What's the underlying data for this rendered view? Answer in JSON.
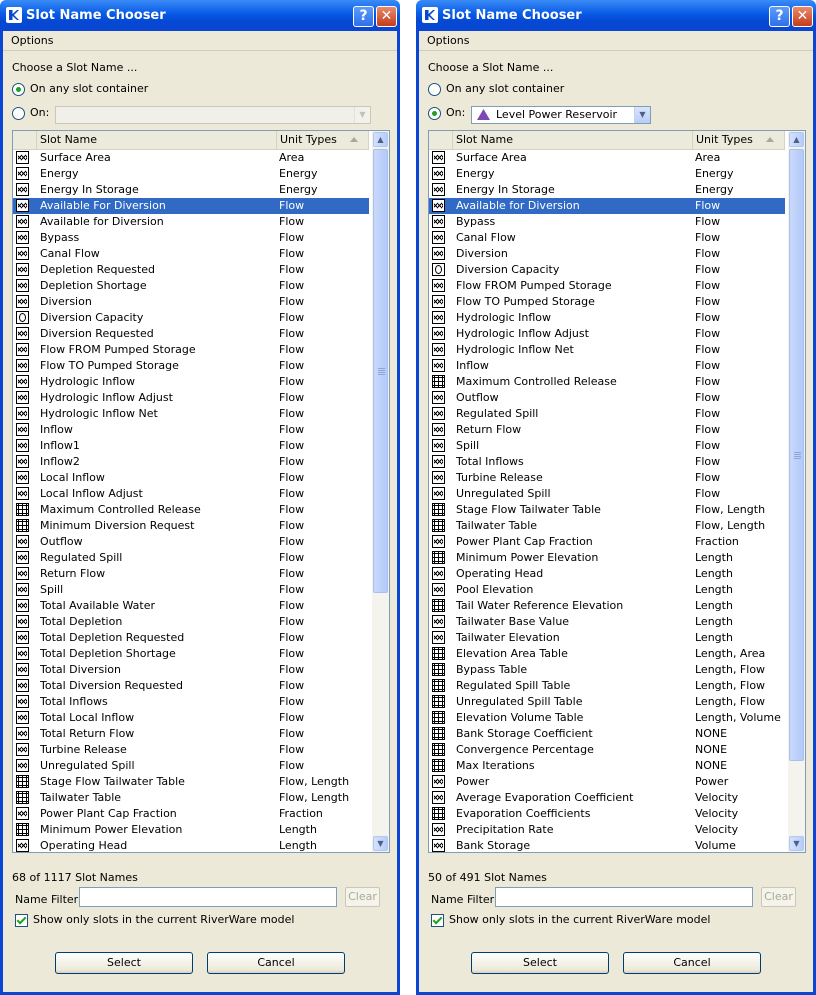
{
  "dialogs": [
    {
      "title": "Slot Name Chooser",
      "menu": "Options",
      "choose_label": "Choose a Slot Name ...",
      "radio_any": "On any slot container",
      "radio_on": "On:",
      "selected_radio": "any",
      "on_value": "",
      "columns": [
        "Slot Name",
        "Unit Types"
      ],
      "selected_index": 3,
      "rows": [
        {
          "icon": "graph",
          "name": "Surface Area",
          "unit": "Area"
        },
        {
          "icon": "graph",
          "name": "Energy",
          "unit": "Energy"
        },
        {
          "icon": "graph",
          "name": "Energy In Storage",
          "unit": "Energy"
        },
        {
          "icon": "graph",
          "name": "Available For Diversion",
          "unit": "Flow"
        },
        {
          "icon": "graph",
          "name": "Available for Diversion",
          "unit": "Flow"
        },
        {
          "icon": "graph",
          "name": "Bypass",
          "unit": "Flow"
        },
        {
          "icon": "graph",
          "name": "Canal Flow",
          "unit": "Flow"
        },
        {
          "icon": "graph",
          "name": "Depletion Requested",
          "unit": "Flow"
        },
        {
          "icon": "graph",
          "name": "Depletion Shortage",
          "unit": "Flow"
        },
        {
          "icon": "graph",
          "name": "Diversion",
          "unit": "Flow"
        },
        {
          "icon": "circle",
          "name": "Diversion Capacity",
          "unit": "Flow"
        },
        {
          "icon": "graph",
          "name": "Diversion Requested",
          "unit": "Flow"
        },
        {
          "icon": "graph",
          "name": "Flow FROM Pumped Storage",
          "unit": "Flow"
        },
        {
          "icon": "graph",
          "name": "Flow TO Pumped Storage",
          "unit": "Flow"
        },
        {
          "icon": "graph",
          "name": "Hydrologic Inflow",
          "unit": "Flow"
        },
        {
          "icon": "graph",
          "name": "Hydrologic Inflow Adjust",
          "unit": "Flow"
        },
        {
          "icon": "graph",
          "name": "Hydrologic Inflow Net",
          "unit": "Flow"
        },
        {
          "icon": "graph",
          "name": "Inflow",
          "unit": "Flow"
        },
        {
          "icon": "graph",
          "name": "Inflow1",
          "unit": "Flow"
        },
        {
          "icon": "graph",
          "name": "Inflow2",
          "unit": "Flow"
        },
        {
          "icon": "graph",
          "name": "Local Inflow",
          "unit": "Flow"
        },
        {
          "icon": "graph",
          "name": "Local Inflow Adjust",
          "unit": "Flow"
        },
        {
          "icon": "table",
          "name": "Maximum Controlled Release",
          "unit": "Flow"
        },
        {
          "icon": "table",
          "name": "Minimum Diversion Request",
          "unit": "Flow"
        },
        {
          "icon": "graph",
          "name": "Outflow",
          "unit": "Flow"
        },
        {
          "icon": "graph",
          "name": "Regulated Spill",
          "unit": "Flow"
        },
        {
          "icon": "graph",
          "name": "Return Flow",
          "unit": "Flow"
        },
        {
          "icon": "graph",
          "name": "Spill",
          "unit": "Flow"
        },
        {
          "icon": "graph",
          "name": "Total Available Water",
          "unit": "Flow"
        },
        {
          "icon": "graph",
          "name": "Total Depletion",
          "unit": "Flow"
        },
        {
          "icon": "graph",
          "name": "Total Depletion Requested",
          "unit": "Flow"
        },
        {
          "icon": "graph",
          "name": "Total Depletion Shortage",
          "unit": "Flow"
        },
        {
          "icon": "graph",
          "name": "Total Diversion",
          "unit": "Flow"
        },
        {
          "icon": "graph",
          "name": "Total Diversion Requested",
          "unit": "Flow"
        },
        {
          "icon": "graph",
          "name": "Total Inflows",
          "unit": "Flow"
        },
        {
          "icon": "graph",
          "name": "Total Local Inflow",
          "unit": "Flow"
        },
        {
          "icon": "graph",
          "name": "Total Return Flow",
          "unit": "Flow"
        },
        {
          "icon": "graph",
          "name": "Turbine Release",
          "unit": "Flow"
        },
        {
          "icon": "graph",
          "name": "Unregulated Spill",
          "unit": "Flow"
        },
        {
          "icon": "table",
          "name": "Stage Flow Tailwater Table",
          "unit": "Flow, Length"
        },
        {
          "icon": "table",
          "name": "Tailwater Table",
          "unit": "Flow, Length"
        },
        {
          "icon": "graph",
          "name": "Power Plant Cap Fraction",
          "unit": "Fraction"
        },
        {
          "icon": "table",
          "name": "Minimum Power Elevation",
          "unit": "Length"
        },
        {
          "icon": "graph",
          "name": "Operating Head",
          "unit": "Length"
        }
      ],
      "count_text": "68 of 1117 Slot Names",
      "filter_label": "Name Filter:",
      "filter_value": "",
      "clear_label": "Clear",
      "checkbox_label": "Show only slots in the current RiverWare model",
      "select_label": "Select",
      "cancel_label": "Cancel"
    },
    {
      "title": "Slot Name Chooser",
      "menu": "Options",
      "choose_label": "Choose a Slot Name ...",
      "radio_any": "On any slot container",
      "radio_on": "On:",
      "selected_radio": "on",
      "on_value": "Level Power Reservoir",
      "columns": [
        "Slot Name",
        "Unit Types"
      ],
      "selected_index": 3,
      "rows": [
        {
          "icon": "graph",
          "name": "Surface Area",
          "unit": "Area"
        },
        {
          "icon": "graph",
          "name": "Energy",
          "unit": "Energy"
        },
        {
          "icon": "graph",
          "name": "Energy In Storage",
          "unit": "Energy"
        },
        {
          "icon": "graph",
          "name": "Available for Diversion",
          "unit": "Flow"
        },
        {
          "icon": "graph",
          "name": "Bypass",
          "unit": "Flow"
        },
        {
          "icon": "graph",
          "name": "Canal Flow",
          "unit": "Flow"
        },
        {
          "icon": "graph",
          "name": "Diversion",
          "unit": "Flow"
        },
        {
          "icon": "circle",
          "name": "Diversion Capacity",
          "unit": "Flow"
        },
        {
          "icon": "graph",
          "name": "Flow FROM Pumped Storage",
          "unit": "Flow"
        },
        {
          "icon": "graph",
          "name": "Flow TO Pumped Storage",
          "unit": "Flow"
        },
        {
          "icon": "graph",
          "name": "Hydrologic Inflow",
          "unit": "Flow"
        },
        {
          "icon": "graph",
          "name": "Hydrologic Inflow Adjust",
          "unit": "Flow"
        },
        {
          "icon": "graph",
          "name": "Hydrologic Inflow Net",
          "unit": "Flow"
        },
        {
          "icon": "graph",
          "name": "Inflow",
          "unit": "Flow"
        },
        {
          "icon": "table",
          "name": "Maximum Controlled Release",
          "unit": "Flow"
        },
        {
          "icon": "graph",
          "name": "Outflow",
          "unit": "Flow"
        },
        {
          "icon": "graph",
          "name": "Regulated Spill",
          "unit": "Flow"
        },
        {
          "icon": "graph",
          "name": "Return Flow",
          "unit": "Flow"
        },
        {
          "icon": "graph",
          "name": "Spill",
          "unit": "Flow"
        },
        {
          "icon": "graph",
          "name": "Total Inflows",
          "unit": "Flow"
        },
        {
          "icon": "graph",
          "name": "Turbine Release",
          "unit": "Flow"
        },
        {
          "icon": "graph",
          "name": "Unregulated Spill",
          "unit": "Flow"
        },
        {
          "icon": "table",
          "name": "Stage Flow Tailwater Table",
          "unit": "Flow, Length"
        },
        {
          "icon": "table",
          "name": "Tailwater Table",
          "unit": "Flow, Length"
        },
        {
          "icon": "graph",
          "name": "Power Plant Cap Fraction",
          "unit": "Fraction"
        },
        {
          "icon": "table",
          "name": "Minimum Power Elevation",
          "unit": "Length"
        },
        {
          "icon": "graph",
          "name": "Operating Head",
          "unit": "Length"
        },
        {
          "icon": "graph",
          "name": "Pool Elevation",
          "unit": "Length"
        },
        {
          "icon": "table",
          "name": "Tail Water Reference Elevation",
          "unit": "Length"
        },
        {
          "icon": "graph",
          "name": "Tailwater Base Value",
          "unit": "Length"
        },
        {
          "icon": "graph",
          "name": "Tailwater Elevation",
          "unit": "Length"
        },
        {
          "icon": "table",
          "name": "Elevation Area Table",
          "unit": "Length, Area"
        },
        {
          "icon": "table",
          "name": "Bypass Table",
          "unit": "Length, Flow"
        },
        {
          "icon": "table",
          "name": "Regulated Spill Table",
          "unit": "Length, Flow"
        },
        {
          "icon": "table",
          "name": "Unregulated Spill Table",
          "unit": "Length, Flow"
        },
        {
          "icon": "table",
          "name": "Elevation Volume Table",
          "unit": "Length, Volume"
        },
        {
          "icon": "table",
          "name": "Bank Storage Coefficient",
          "unit": "NONE"
        },
        {
          "icon": "table",
          "name": "Convergence Percentage",
          "unit": "NONE"
        },
        {
          "icon": "table",
          "name": "Max Iterations",
          "unit": "NONE"
        },
        {
          "icon": "graph",
          "name": "Power",
          "unit": "Power"
        },
        {
          "icon": "graph",
          "name": "Average Evaporation Coefficient",
          "unit": "Velocity"
        },
        {
          "icon": "table",
          "name": "Evaporation Coefficients",
          "unit": "Velocity"
        },
        {
          "icon": "graph",
          "name": "Precipitation Rate",
          "unit": "Velocity"
        },
        {
          "icon": "graph",
          "name": "Bank Storage",
          "unit": "Volume"
        }
      ],
      "count_text": "50 of 491 Slot Names",
      "filter_label": "Name Filter:",
      "filter_value": "",
      "clear_label": "Clear",
      "checkbox_label": "Show only slots in the current RiverWare model",
      "select_label": "Select",
      "cancel_label": "Cancel"
    }
  ],
  "icons": {
    "graph": "slot-graph-icon",
    "table": "table-slot-icon",
    "circle": "agg-slot-icon",
    "help": "?",
    "close": "✕",
    "scroll_up": "▲",
    "scroll_down": "▼",
    "dropdown": "▼"
  },
  "colors": {
    "title_bar": "#0a46d5",
    "selection": "#316ac5",
    "dialog_bg": "#ece9d8",
    "radio_dot": "#21a121",
    "reservoir_icon": "#7e47b8"
  }
}
